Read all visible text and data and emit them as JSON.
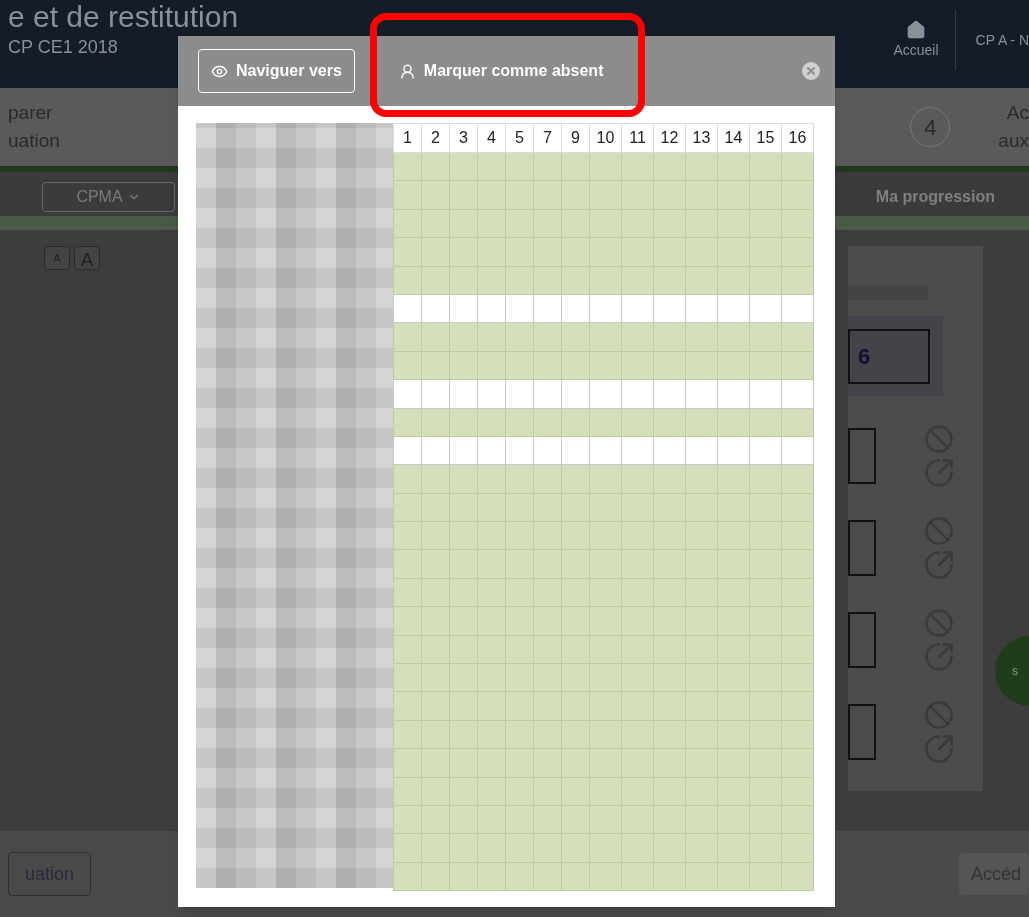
{
  "background": {
    "header": {
      "title": "e et de restitution",
      "subtitle": "CP CE1 2018",
      "nav": [
        {
          "label": "Accueil",
          "kind": "home"
        },
        {
          "label": "CP A - N",
          "kind": "text"
        }
      ]
    },
    "stepper": {
      "left": [
        "parer",
        "uation"
      ],
      "step_number": "4",
      "right": [
        "Ac",
        "aux"
      ]
    },
    "toolbar": {
      "dropdown": "CPMA",
      "tab": "Ma progression"
    },
    "font_buttons": [
      "A",
      "A"
    ],
    "score": "6",
    "round_button": "s",
    "bottom": {
      "left_button": "uation",
      "right_button": "Accéd"
    }
  },
  "modal": {
    "buttons": [
      {
        "label": "Naviguer vers",
        "kind": "navigate",
        "highlighted": false
      },
      {
        "label": "Marquer comme absent",
        "kind": "absent",
        "highlighted": true
      }
    ],
    "columns": [
      "1",
      "2",
      "3",
      "4",
      "5",
      "7",
      "9",
      "10",
      "11",
      "12",
      "13",
      "14",
      "15",
      "16"
    ],
    "rows": [
      {
        "filled": true
      },
      {
        "filled": true
      },
      {
        "filled": true
      },
      {
        "filled": true
      },
      {
        "filled": true
      },
      {
        "filled": false
      },
      {
        "filled": true
      },
      {
        "filled": true
      },
      {
        "filled": false
      },
      {
        "filled": true
      },
      {
        "filled": false
      },
      {
        "filled": true
      },
      {
        "filled": true
      },
      {
        "filled": true
      },
      {
        "filled": true
      },
      {
        "filled": true
      },
      {
        "filled": true
      },
      {
        "filled": true
      },
      {
        "filled": true
      },
      {
        "filled": true
      },
      {
        "filled": true
      },
      {
        "filled": true
      },
      {
        "filled": true
      },
      {
        "filled": true
      },
      {
        "filled": true
      },
      {
        "filled": true
      }
    ]
  }
}
